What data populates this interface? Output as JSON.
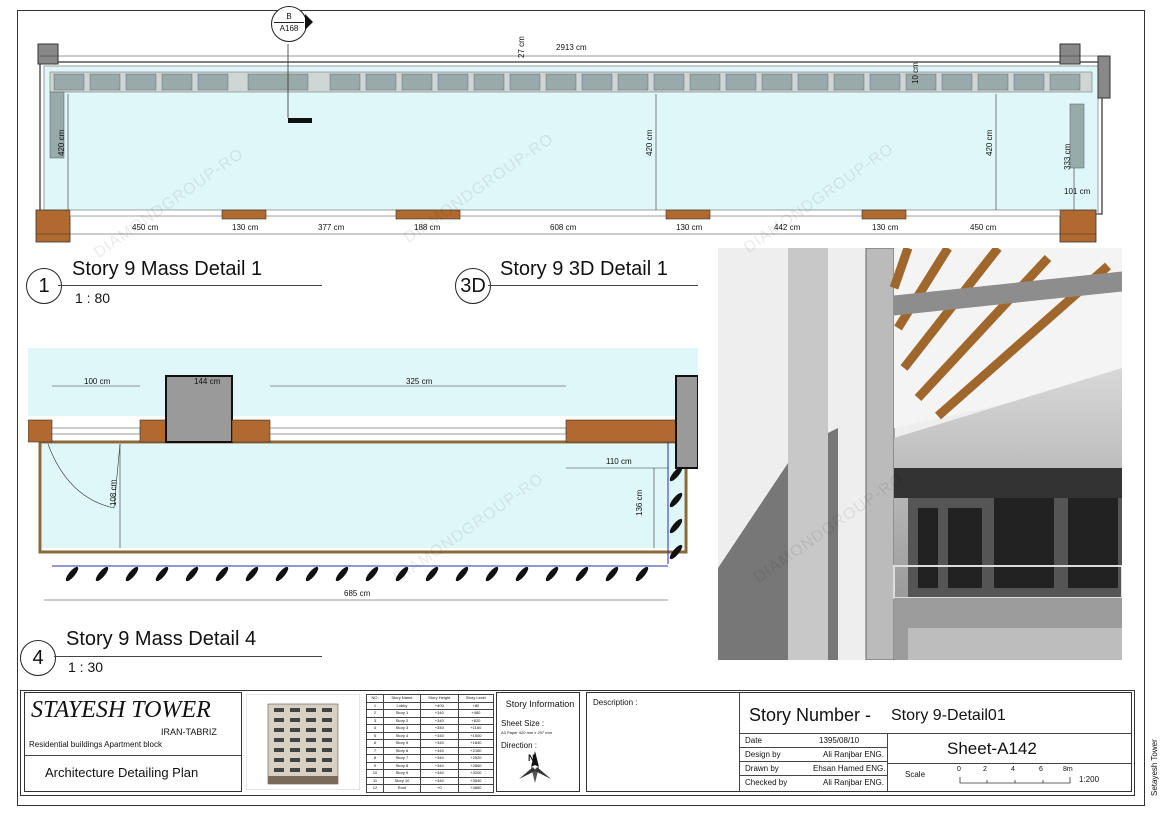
{
  "views": {
    "v1": {
      "number": "1",
      "title": "Story 9 Mass Detail 1",
      "scale": "1 : 80"
    },
    "v3d": {
      "number": "3D",
      "title": "Story 9 3D Detail 1"
    },
    "v4": {
      "number": "4",
      "title": "Story 9 Mass Detail 4",
      "scale": "1 : 30"
    }
  },
  "plan1": {
    "section_tag_top": "B",
    "section_tag_bottom": "A168",
    "overall_dim": "2913 cm",
    "top_dim": "27 cm",
    "right_dim": "10 cm",
    "heights": [
      "420 cm",
      "420 cm",
      "420 cm",
      "333 cm"
    ],
    "right_bottom_dim": "101 cm",
    "bottom_dims": [
      "450 cm",
      "130 cm",
      "377 cm",
      "188 cm",
      "608 cm",
      "130 cm",
      "442 cm",
      "130 cm",
      "450 cm"
    ]
  },
  "plan4": {
    "dims_top": [
      "100 cm",
      "144 cm",
      "325 cm"
    ],
    "dim_110": "110 cm",
    "dim_108": "108 cm",
    "dim_136": "136 cm",
    "dim_total": "685 cm"
  },
  "titleblock": {
    "project": "STAYESH TOWER",
    "location": "IRAN-TABRIZ",
    "subtitle": "Residential buildings Apartment block",
    "plan_name": "Architecture Detailing Plan",
    "story_table": {
      "headers": [
        "NO.",
        "Story Name",
        "Story Height",
        "Story Level"
      ],
      "rows": [
        [
          "1",
          "Lobby",
          "+400",
          "+80"
        ],
        [
          "2",
          "Story 1",
          "+340",
          "+480"
        ],
        [
          "3",
          "Story 2",
          "+340",
          "+820"
        ],
        [
          "4",
          "Story 3",
          "+340",
          "+1160"
        ],
        [
          "5",
          "Story 4",
          "+340",
          "+1500"
        ],
        [
          "6",
          "Story 5",
          "+340",
          "+1840"
        ],
        [
          "7",
          "Story 6",
          "+340",
          "+2180"
        ],
        [
          "8",
          "Story 7",
          "+340",
          "+2520"
        ],
        [
          "9",
          "Story 8",
          "+340",
          "+2860"
        ],
        [
          "10",
          "Story 9",
          "+340",
          "+3200"
        ],
        [
          "11",
          "Story 10",
          "+340",
          "+3540"
        ],
        [
          "12",
          "Roof",
          "+0",
          "+3880"
        ]
      ]
    },
    "story_info_label": "Story Information",
    "sheet_size_label": "Sheet Size :",
    "sheet_size_value": "A3 Paper 420 mm x 297 mm",
    "direction_label": "Direction :",
    "north_label": "N",
    "description_label": "Description :",
    "story_number_label": "Story Number -",
    "story_number_value": "Story 9-Detail01",
    "date_label": "Date",
    "date_value": "1395/08/10",
    "design_label": "Design by",
    "design_value": "Ali Ranjbar ENG.",
    "drawn_label": "Drawn by",
    "drawn_value": "Ehsan Hamed ENG.",
    "checked_label": "Checked by",
    "checked_value": "Ali Ranjbar ENG.",
    "sheet_no": "Sheet-A142",
    "scale_label": "Scale",
    "scale_ticks": [
      "0",
      "2",
      "4",
      "6",
      "8m"
    ],
    "scale_value": "1:200",
    "side_label": "Setayesh Tower"
  },
  "watermark": "DIAMONDGROUP-RO"
}
